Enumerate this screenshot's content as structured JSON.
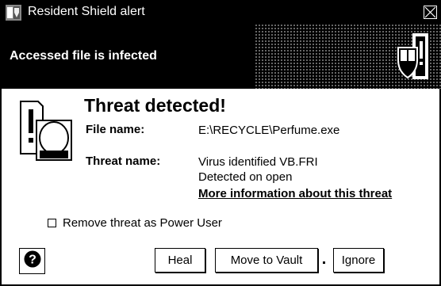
{
  "window": {
    "title": "Resident Shield alert"
  },
  "header": {
    "message": "Accessed file is infected"
  },
  "threat": {
    "heading": "Threat detected!",
    "file_label": "File name:",
    "file_value": "E:\\RECYCLE\\Perfume.exe",
    "threat_label": "Threat name:",
    "threat_value": "Virus identified VB.FRI",
    "detection": "Detected on open",
    "more_info_link": "More information about this threat"
  },
  "options": {
    "remove_checkbox_label": "Remove threat as Power User",
    "remove_checked": false
  },
  "buttons": {
    "heal": "Heal",
    "move_to_vault": "Move to Vault",
    "ignore": "Ignore",
    "separator": "."
  },
  "icons": {
    "title_icon": "shield-app-icon",
    "header_icon": "shield-alert-icon",
    "threat_icon": "infected-file-icon",
    "help_icon": "question-mark-icon",
    "close_icon": "close-icon"
  }
}
